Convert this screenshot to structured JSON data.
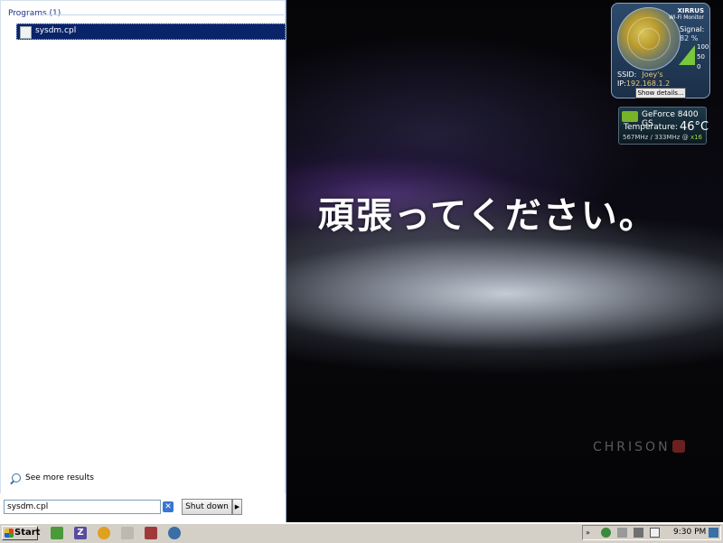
{
  "desktop": {
    "slogan": "頑張ってください。",
    "brand": "CHRISON"
  },
  "wifi_gadget": {
    "brand": "XIRRUS",
    "subtitle": "Wi-Fi Monitor",
    "signal_label": "Signal:",
    "signal_value": "82 %",
    "signal_level": 0.82,
    "scale": [
      "100",
      "50",
      "0"
    ],
    "ssid_label": "SSID:",
    "ssid_value": "Joey's",
    "ip_label": "IP:",
    "ip_value": "192.168.1.2",
    "details_button": "Show details..."
  },
  "gpu_gadget": {
    "name": "GeForce 8400 GS",
    "temp_label": "Temperature:",
    "temp_value": "46°C",
    "clock_text": "567MHz / 333MHz @",
    "clock_bus": "x16"
  },
  "start_menu": {
    "programs_header": "Programs (1)",
    "results": [
      {
        "label": "sysdm.cpl",
        "selected": true
      }
    ],
    "see_more": "See more results",
    "search_value": "sysdm.cpl",
    "shutdown_label": "Shut down",
    "shutdown_arrow": "▶"
  },
  "taskbar": {
    "start_label": "Start",
    "clock": "9:30 PM"
  },
  "colors": {
    "selection": "#0a246a",
    "taskbar": "#d4d0c8"
  }
}
